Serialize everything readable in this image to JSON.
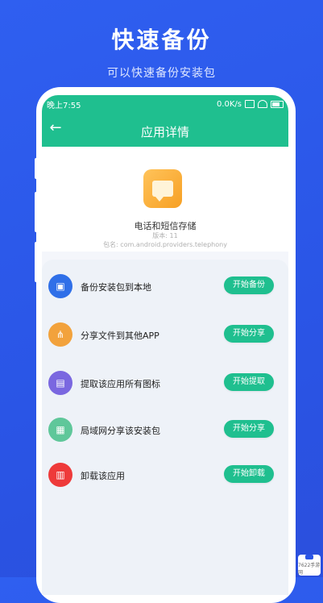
{
  "promo": {
    "title": "快速备份",
    "subtitle": "可以快速备份安装包"
  },
  "status_bar": {
    "time": "晚上7:55",
    "network_speed": "0.0K/s"
  },
  "app_bar": {
    "title": "应用详情",
    "back_icon": "arrow-left-icon"
  },
  "app_info": {
    "name": "电话和短信存储",
    "version": "版本: 11",
    "package": "包名: com.android.providers.telephony",
    "icon": "message-bubble-icon"
  },
  "actions": [
    {
      "label": "备份安装包到本地",
      "button": "开始备份",
      "icon": "save-icon",
      "color": "#2f6fe8"
    },
    {
      "label": "分享文件到其他APP",
      "button": "开始分享",
      "icon": "share-icon",
      "color": "#f2a23c"
    },
    {
      "label": "提取该应用所有图标",
      "button": "开始提取",
      "icon": "image-icon",
      "color": "#7a67e0"
    },
    {
      "label": "局域网分享该安装包",
      "button": "开始分享",
      "icon": "lan-share-icon",
      "color": "#5fc79a"
    },
    {
      "label": "卸载该应用",
      "button": "开始卸载",
      "icon": "trash-icon",
      "color": "#ee3a3a"
    }
  ],
  "colors": {
    "accent": "#1fbf8f",
    "background": "#2a55e6"
  },
  "watermark": {
    "text": "7622手游网"
  }
}
